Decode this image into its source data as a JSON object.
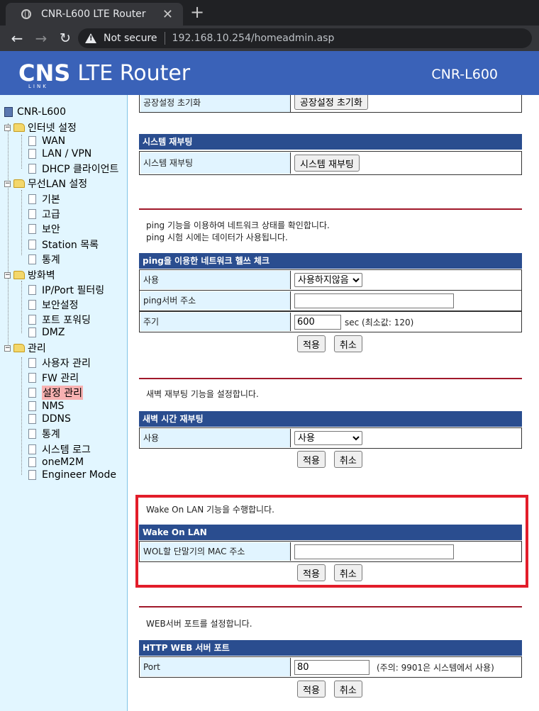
{
  "browser": {
    "tab_title": "CNR-L600 LTE Router",
    "tab_close": "✕",
    "new_tab": "+",
    "back": "←",
    "forward": "→",
    "reload": "↻",
    "security_label": "Not secure",
    "url": "192.168.10.254/homeadmin.asp"
  },
  "header": {
    "logo_brand": "CNS",
    "logo_sub": "LINK",
    "logo_product": "LTE Router",
    "model": "CNR-L600"
  },
  "sidebar": {
    "root": "CNR-L600",
    "groups": [
      {
        "label": "인터넷 설정",
        "items": [
          "WAN",
          "LAN / VPN",
          "DHCP 클라이언트"
        ]
      },
      {
        "label": "무선LAN 설정",
        "items": [
          "기본",
          "고급",
          "보안",
          "Station 목록",
          "통계"
        ]
      },
      {
        "label": "방화벽",
        "items": [
          "IP/Port 필터링",
          "보안설정",
          "포트 포워딩",
          "DMZ"
        ]
      },
      {
        "label": "관리",
        "items": [
          "사용자 관리",
          "FW 관리",
          "설정 관리",
          "NMS",
          "DDNS",
          "통계",
          "시스템 로그",
          "oneM2M",
          "Engineer Mode"
        ]
      }
    ]
  },
  "content": {
    "factory_reset": {
      "label": "공장설정 초기화",
      "button": "공장설정 초기화"
    },
    "reboot": {
      "title": "시스템 재부팅",
      "label": "시스템 재부팅",
      "button": "시스템 재부팅"
    },
    "ping": {
      "desc1": "ping 기능을 이용하여 네트워크 상태를 확인합니다.",
      "desc2": "ping 시험 시에는 데이터가 사용됩니다.",
      "title": "ping을 이용한 네트워크 헬쓰 체크",
      "use_label": "사용",
      "use_value": "사용하지않음",
      "server_label": "ping서버 주소",
      "server_value": "",
      "period_label": "주기",
      "period_value": "600",
      "period_unit": "sec (최소값: 120)",
      "apply": "적용",
      "cancel": "취소"
    },
    "dawn_reboot": {
      "desc": "새벽 재부팅 기능을 설정합니다.",
      "title": "새벽 시간 재부팅",
      "use_label": "사용",
      "use_value": "사용",
      "apply": "적용",
      "cancel": "취소"
    },
    "wol": {
      "desc": "Wake On LAN 기능을 수행합니다.",
      "title": "Wake On LAN",
      "mac_label": "WOL할 단말기의 MAC 주소",
      "mac_value": "",
      "apply": "적용",
      "cancel": "취소"
    },
    "web_port": {
      "desc": "WEB서버 포트를 설정합니다.",
      "title": "HTTP WEB 서버 포트",
      "port_label": "Port",
      "port_value": "80",
      "port_note": "(주의: 9901은 시스템에서 사용)",
      "apply": "적용",
      "cancel": "취소"
    }
  },
  "colors": {
    "header_bg": "#3a62b8",
    "section_title_bg": "#2a4d8f",
    "label_cell_bg": "#e1f4ff",
    "sidebar_bg": "#e2f6ff",
    "divider": "#a0182a",
    "highlight": "#e21d2a",
    "selected_item": "#f7b1b1"
  }
}
